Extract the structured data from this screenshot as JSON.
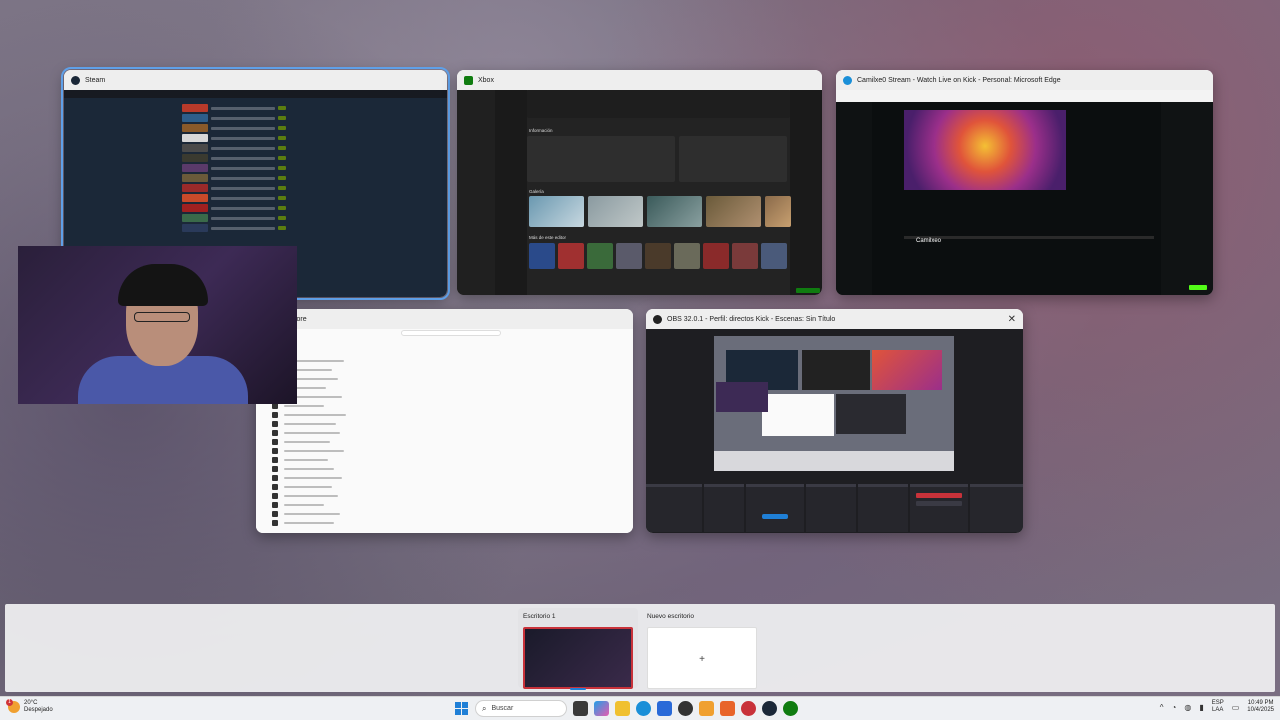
{
  "windows": {
    "steam": {
      "title": "Steam"
    },
    "xbox": {
      "title": "Xbox"
    },
    "edge": {
      "title": "Camilxe0 Stream - Watch Live on Kick - Personal: Microsoft Edge",
      "streamer": "Camilxeo"
    },
    "store": {
      "title": "t Store"
    },
    "obs": {
      "title": "OBS 32.0.1 - Perfil: directos Kick - Escenas: Sin Título",
      "close": "✕"
    }
  },
  "xbox_sections": {
    "info": "Información",
    "gallery": "Galería",
    "more": "Más de este editor"
  },
  "desktops": {
    "current": "Escritorio 1",
    "new": "Nuevo escritorio",
    "plus": "+"
  },
  "taskbar": {
    "weather_temp": "20°C",
    "weather_desc": "Despejado",
    "weather_badge": "1",
    "search_placeholder": "Buscar",
    "lang_top": "ESP",
    "lang_bottom": "LAA",
    "time": "10:49 PM",
    "date": "10/4/2025"
  },
  "colors": {
    "accent": "#5fa0e8",
    "kick_green": "#53fc18",
    "steam_bg": "#1b2838",
    "xbox_green": "#107c10"
  }
}
